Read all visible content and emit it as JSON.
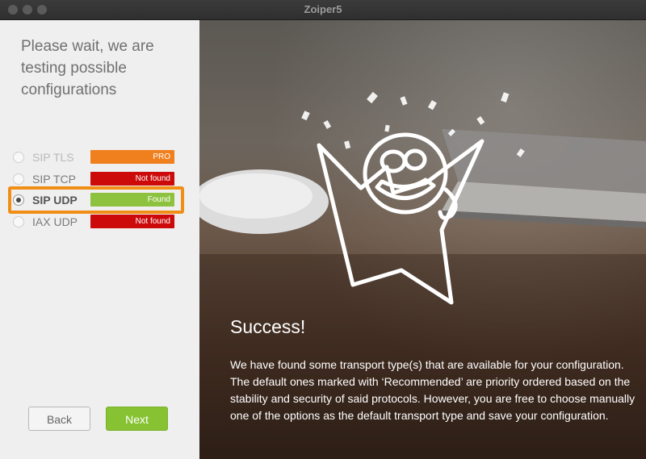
{
  "window": {
    "title": "Zoiper5"
  },
  "left": {
    "heading": "Please wait, we are testing possible configurations",
    "options": [
      {
        "label": "SIP TLS",
        "status": "PRO",
        "status_color": "#f07f1d",
        "label_color": "#b9b9b9",
        "selected": false,
        "disabled": true
      },
      {
        "label": "SIP TCP",
        "status": "Not found",
        "status_color": "#cc0a0a",
        "label_color": "#7b7b7b",
        "selected": false,
        "disabled": false
      },
      {
        "label": "SIP UDP",
        "status": "Found",
        "status_color": "#8cc23d",
        "label_color": "#555555",
        "selected": true,
        "disabled": false
      },
      {
        "label": "IAX UDP",
        "status": "Not found",
        "status_color": "#cc0a0a",
        "label_color": "#7b7b7b",
        "selected": false,
        "disabled": false
      }
    ],
    "highlight_color": "#f08e15",
    "back_label": "Back",
    "next_label": "Next"
  },
  "right": {
    "illustration": "celebrating-mascot-icon",
    "success_title": "Success!",
    "paragraph1": "We have found some transport type(s) that are available for your configuration.",
    "paragraph2": "The default ones marked with ‘Recommended’ are priority ordered based on the stability and security of said protocols. However, you are free to choose manually one of the options as the default  transport type and save your configuration."
  }
}
